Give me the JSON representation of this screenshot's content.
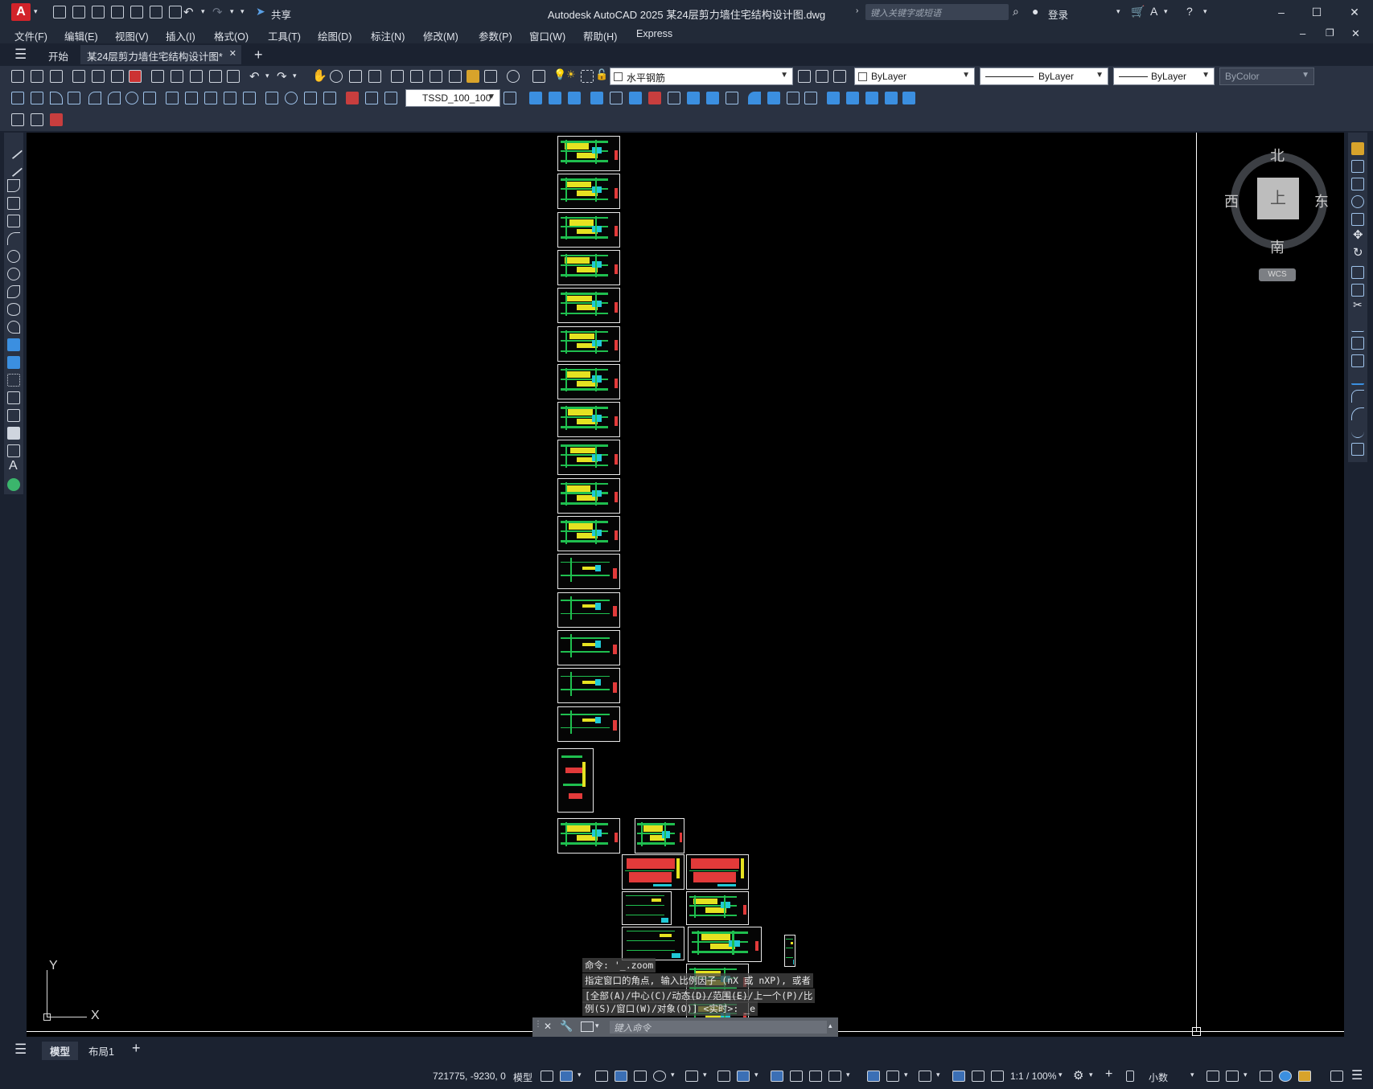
{
  "titlebar": {
    "logo": "A",
    "title": "Autodesk AutoCAD 2025    某24层剪力墙住宅结构设计图.dwg",
    "share_label": "共享",
    "search_placeholder": "键入关键字或短语",
    "login_label": "登录"
  },
  "menu": [
    "文件(F)",
    "编辑(E)",
    "视图(V)",
    "插入(I)",
    "格式(O)",
    "工具(T)",
    "绘图(D)",
    "标注(N)",
    "修改(M)",
    "参数(P)",
    "窗口(W)",
    "帮助(H)",
    "Express"
  ],
  "tabs": {
    "start": "开始",
    "drawing": "某24层剪力墙住宅结构设计图*",
    "add": "+"
  },
  "properties": {
    "layer": "水平钢筋",
    "color": "ByLayer",
    "linetype": "ByLayer",
    "lineweight": "ByLayer",
    "plotstyle": "ByColor",
    "dimstyle": "TSSD_100_100"
  },
  "viewcube": {
    "north": "北",
    "south": "南",
    "east": "东",
    "west": "西",
    "face": "上",
    "wcs": "WCS"
  },
  "ucs": {
    "x": "X",
    "y": "Y"
  },
  "command": {
    "history": [
      "命令: '_.zoom",
      "指定窗口的角点, 输入比例因子 (nX 或 nXP), 或者",
      "[全部(A)/中心(C)/动态(D)/范围(E)/上一个(P)/比",
      "例(S)/窗口(W)/对象(O)] <实时>: _e"
    ],
    "input_placeholder": "键入命令"
  },
  "layout_tabs": [
    "模型",
    "布局1"
  ],
  "status": {
    "coordinates": "721775, -9230, 0",
    "model_label": "模型",
    "annotation_scale": "1:1 / 100%",
    "units": "小数"
  },
  "colors": {
    "canvas": "#000000",
    "chrome": "#222a38",
    "accent": "#d2232a"
  }
}
